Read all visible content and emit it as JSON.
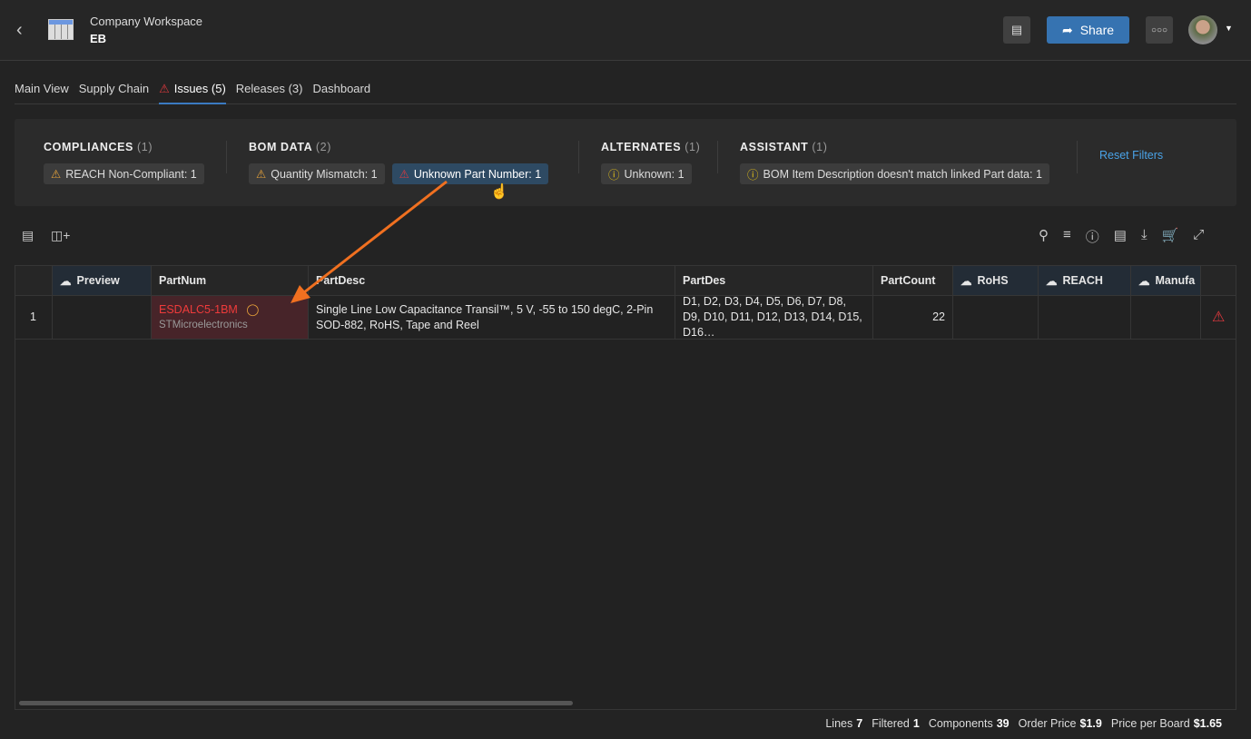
{
  "header": {
    "workspace": "Company Workspace",
    "project": "EB",
    "share_label": "Share"
  },
  "tabs": [
    {
      "label": "Main View"
    },
    {
      "label": "Supply Chain"
    },
    {
      "label": "Issues (5)"
    },
    {
      "label": "Releases (3)"
    },
    {
      "label": "Dashboard"
    }
  ],
  "filters": {
    "groups": [
      {
        "title": "COMPLIANCES",
        "count": "(1)",
        "chips": [
          "REACH Non-Compliant: 1"
        ]
      },
      {
        "title": "BOM DATA",
        "count": "(2)",
        "chips": [
          "Quantity Mismatch: 1",
          "Unknown Part Number: 1"
        ]
      },
      {
        "title": "ALTERNATES",
        "count": "(1)",
        "chips": [
          "Unknown: 1"
        ]
      },
      {
        "title": "ASSISTANT",
        "count": "(1)",
        "chips": [
          "BOM Item Description doesn't match linked Part data: 1"
        ]
      }
    ],
    "reset_label": "Reset Filters"
  },
  "table": {
    "columns": [
      "Preview",
      "PartNum",
      "PartDesc",
      "PartDes",
      "PartCount",
      "RoHS",
      "REACH",
      "Manufa"
    ],
    "rows": [
      {
        "index": "1",
        "partnum": "ESDALC5-1BM",
        "manufacturer": "STMicroelectronics",
        "partdesc": "Single Line Low Capacitance Transil™, 5 V, -55 to 150 degC, 2-Pin SOD-882, RoHS, Tape and Reel",
        "partdes": "D1, D2, D3, D4, D5, D6, D7, D8, D9, D10, D11, D12, D13, D14, D15, D16…",
        "partcount": "22"
      }
    ]
  },
  "footer": {
    "lines_label": "Lines",
    "lines": "7",
    "filtered_label": "Filtered",
    "filtered": "1",
    "components_label": "Components",
    "components": "39",
    "order_price_label": "Order Price",
    "order_price": "$1.9",
    "ppb_label": "Price per Board",
    "ppb": "$1.65"
  },
  "colors": {
    "accent": "#3b7ac2",
    "error": "#e0393e",
    "warning": "#e8a33a",
    "annotation": "#f07020"
  }
}
